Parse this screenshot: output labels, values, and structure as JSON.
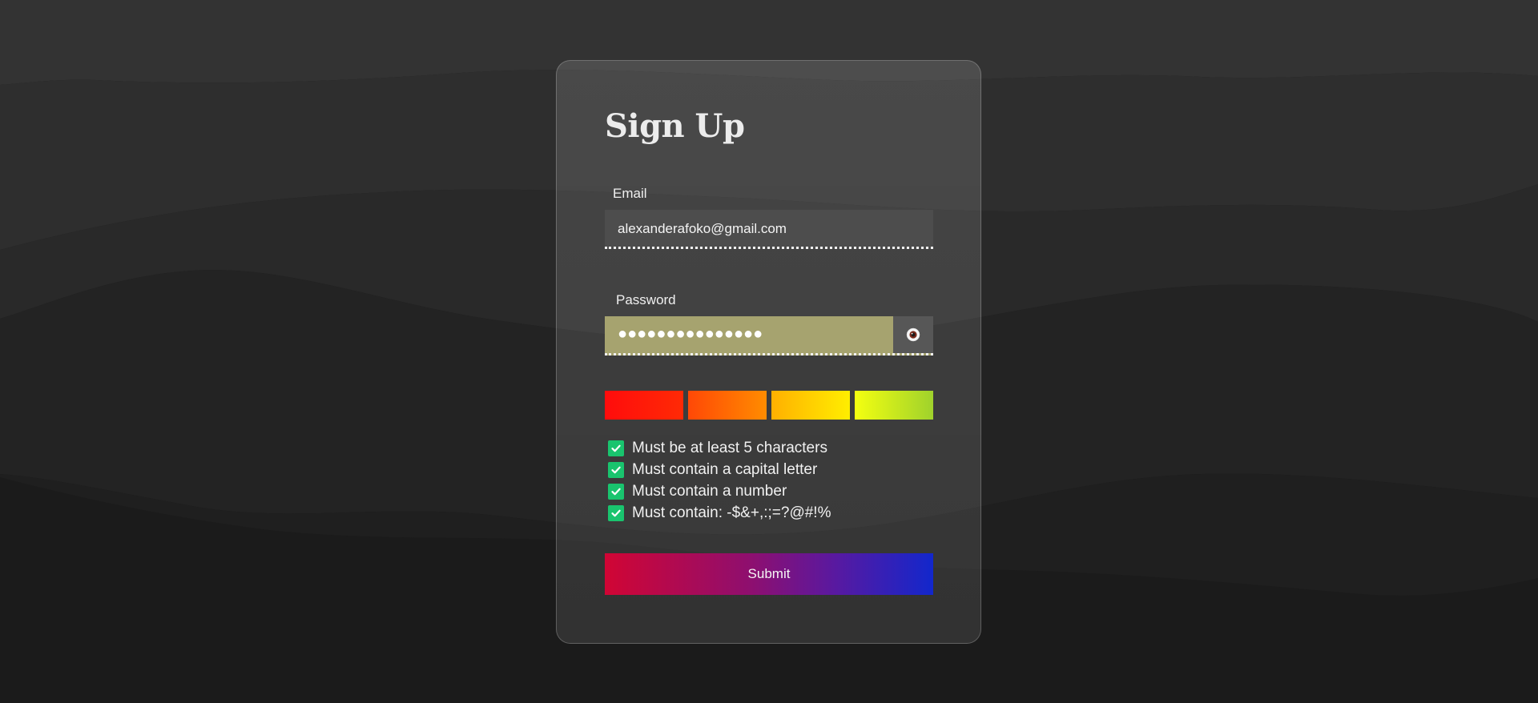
{
  "form": {
    "title": "Sign Up",
    "email": {
      "label": "Email",
      "value": "alexanderafoko@gmail.com"
    },
    "password": {
      "label": "Password",
      "value": "●●●●●●●●●●●●●●●",
      "toggle_icon": "eye-icon"
    },
    "strength": {
      "segments_filled": 4,
      "segments_total": 4,
      "colors": [
        "#ff1a0a",
        "#ff6a03",
        "#ffd000",
        "#cfe81e"
      ]
    },
    "requirements": [
      {
        "text": "Must be at least 5 characters",
        "checked": true
      },
      {
        "text": "Must contain a capital letter",
        "checked": true
      },
      {
        "text": "Must contain a number",
        "checked": true
      },
      {
        "text": "Must contain: -$&+,:;=?@#!%",
        "checked": true
      }
    ],
    "submit_label": "Submit"
  },
  "colors": {
    "background": "#1b1b1b",
    "check": "#19c46e",
    "submit_start": "#d10534",
    "submit_end": "#1227cc",
    "password_fill": "#a6a36f"
  }
}
